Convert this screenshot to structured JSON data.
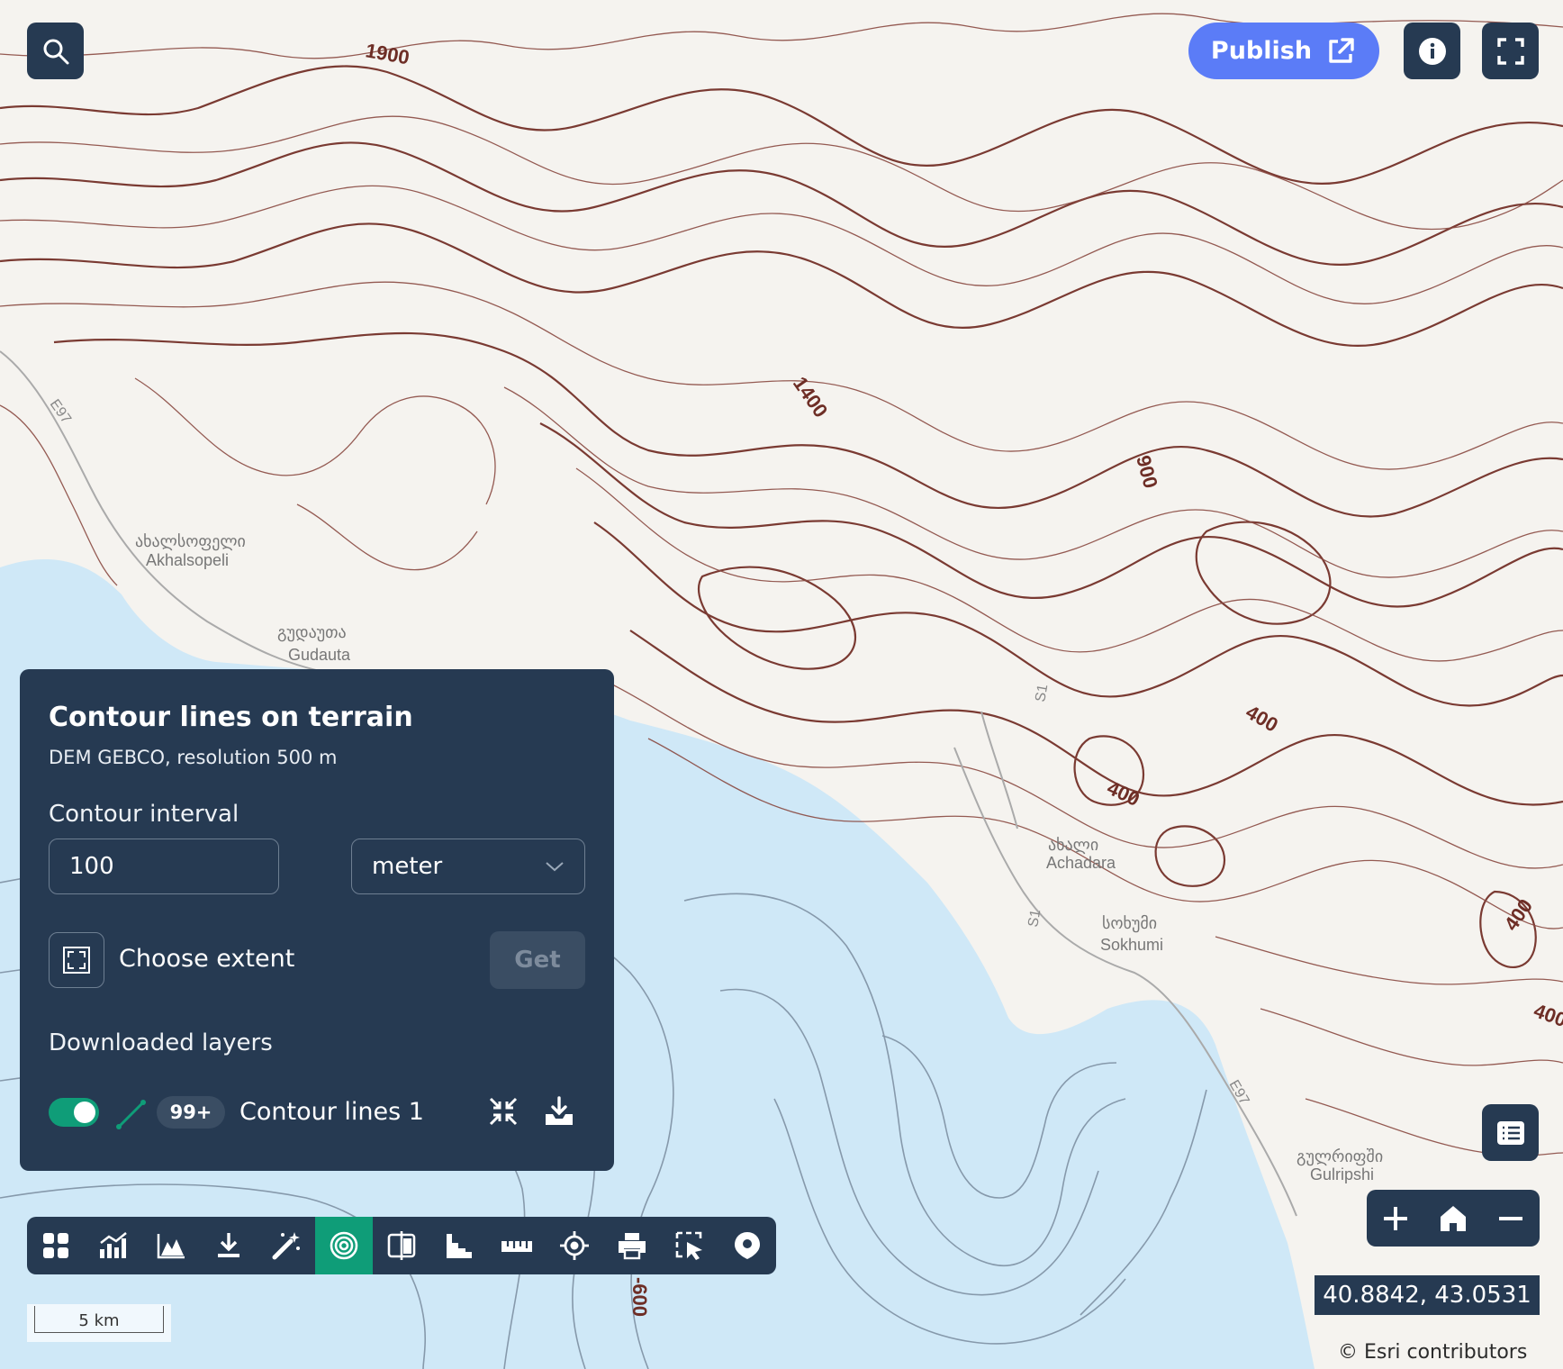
{
  "header": {
    "publish_label": "Publish"
  },
  "map": {
    "towns": [
      {
        "native": "ახალსოფელი",
        "name": "Akhalsopeli"
      },
      {
        "native": "გუდაუთა",
        "name": "Gudauta"
      },
      {
        "native": "ახალი",
        "name": "Achadara"
      },
      {
        "native": "სოხუმი",
        "name": "Sokhumi"
      },
      {
        "native": "გულრიფში",
        "name": "Gulripshi"
      }
    ],
    "contour_labels": [
      "1900",
      "1400",
      "900",
      "400",
      "400",
      "400",
      "400",
      "-600"
    ],
    "roads": [
      "E97",
      "E97",
      "S1",
      "S1"
    ]
  },
  "panel": {
    "title": "Contour lines on terrain",
    "subtitle": "DEM GEBCO, resolution 500 m",
    "interval_label": "Contour interval",
    "interval_value": "100",
    "unit_value": "meter",
    "extent_label": "Choose extent",
    "get_label": "Get",
    "downloaded_label": "Downloaded layers",
    "layer": {
      "badge": "99+",
      "name": "Contour lines 1",
      "visible": true
    }
  },
  "toolbar": {
    "tools": [
      "grid-icon",
      "chart-icon",
      "elevation-icon",
      "download-icon",
      "magic-wand-icon",
      "contour-icon",
      "map-compare-icon",
      "profile-icon",
      "ruler-icon",
      "locate-icon",
      "print-icon",
      "select-icon",
      "pin-icon"
    ],
    "active_tool": "contour-icon"
  },
  "status": {
    "coordinates": "40.8842, 43.0531",
    "attribution": "© Esri contributors",
    "scale": "5 km"
  },
  "colors": {
    "panel_bg": "#263a52",
    "accent_green": "#0f9d78",
    "publish_blue": "#5b7cf7",
    "contour": "#7a3a32",
    "sea": "#cfe8f7"
  }
}
